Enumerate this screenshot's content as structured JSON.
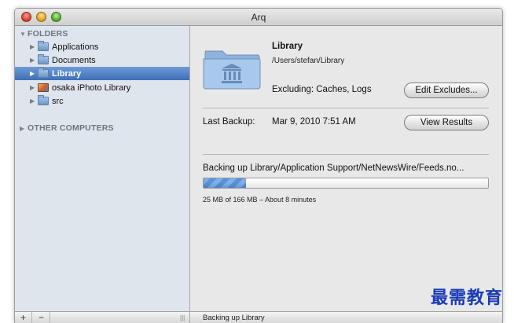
{
  "window": {
    "title": "Arq"
  },
  "sidebar": {
    "folders_header": "FOLDERS",
    "items": [
      {
        "label": "Applications",
        "icon": "folder-icon"
      },
      {
        "label": "Documents",
        "icon": "folder-icon"
      },
      {
        "label": "Library",
        "icon": "folder-icon",
        "selected": true
      },
      {
        "label": "osaka iPhoto Library",
        "icon": "iphoto-library-icon"
      },
      {
        "label": "src",
        "icon": "folder-icon"
      }
    ],
    "other_header": "OTHER COMPUTERS",
    "add_label": "+",
    "remove_label": "−"
  },
  "detail": {
    "name": "Library",
    "path": "/Users/stefan/Library",
    "excluding": "Excluding: Caches, Logs",
    "edit_excludes_label": "Edit Excludes...",
    "last_backup_label": "Last Backup:",
    "last_backup_value": "Mar 9, 2010 7:51 AM",
    "view_results_label": "View Results",
    "status_text": "Backing up Library/Application Support/NetNewsWire/Feeds.no...",
    "progress_fraction": 0.15,
    "size_text": "25 MB of 166 MB – About 8 minutes",
    "bottom_status": "Backing up Library"
  },
  "watermark": "最需教育",
  "colors": {
    "selection": "#3d6fb9",
    "sidebar_bg": "#dfe5ed",
    "progress": "#5a92db",
    "watermark": "#1a3bb5"
  }
}
